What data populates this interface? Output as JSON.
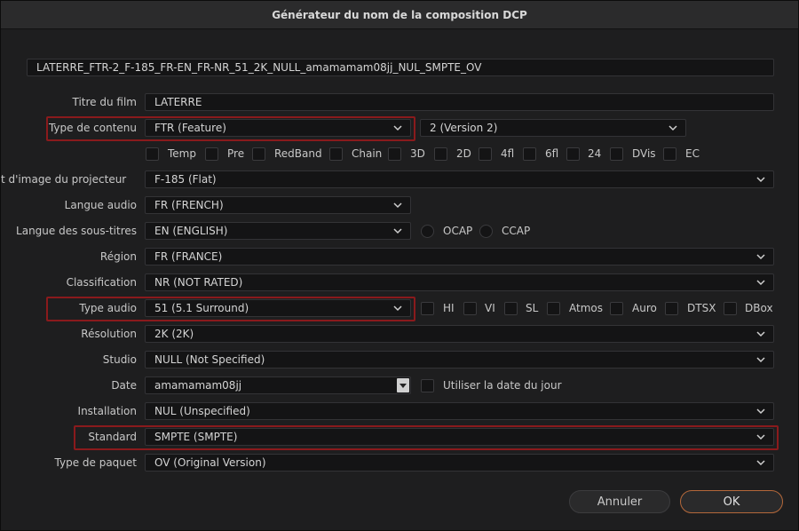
{
  "window": {
    "title": "Générateur du nom de la composition DCP"
  },
  "composition_name": "LATERRE_FTR-2_F-185_FR-EN_FR-NR_51_2K_NULL_amamamam08jj_NUL_SMPTE_OV",
  "rows": {
    "titre": {
      "label": "Titre du film",
      "value": "LATERRE"
    },
    "type_contenu": {
      "label": "Type de contenu",
      "value": "FTR (Feature)",
      "version": "2 (Version 2)"
    },
    "content_flags": [
      "Temp",
      "Pre",
      "RedBand",
      "Chain",
      "3D",
      "2D",
      "4fl",
      "6fl",
      "24",
      "DVis",
      "EC"
    ],
    "format_image": {
      "label": "t d'image du projecteur",
      "value": "F-185 (Flat)"
    },
    "langue_audio": {
      "label": "Langue audio",
      "value": "FR (FRENCH)"
    },
    "langue_sous_titres": {
      "label": "Langue des sous-titres",
      "value": "EN (ENGLISH)",
      "radios": [
        "OCAP",
        "CCAP"
      ]
    },
    "region": {
      "label": "Région",
      "value": "FR (FRANCE)"
    },
    "classification": {
      "label": "Classification",
      "value": "NR (NOT RATED)"
    },
    "type_audio": {
      "label": "Type audio",
      "value": "51 (5.1 Surround)"
    },
    "audio_flags": [
      "HI",
      "VI",
      "SL",
      "Atmos",
      "Auro",
      "DTSX",
      "DBox"
    ],
    "resolution": {
      "label": "Résolution",
      "value": "2K (2K)"
    },
    "studio": {
      "label": "Studio",
      "value": "NULL (Not Specified)"
    },
    "date": {
      "label": "Date",
      "value": "amamamam08jj",
      "today_label": "Utiliser la date du jour"
    },
    "installation": {
      "label": "Installation",
      "value": "NUL (Unspecified)"
    },
    "standard": {
      "label": "Standard",
      "value": "SMPTE (SMPTE)"
    },
    "type_paquet": {
      "label": "Type de paquet",
      "value": "OV (Original Version)"
    }
  },
  "buttons": {
    "cancel": "Annuler",
    "ok": "OK"
  },
  "colors": {
    "highlight": "#8a1a1c",
    "ok_border": "#b4683a",
    "background": "#1e1e1f"
  }
}
